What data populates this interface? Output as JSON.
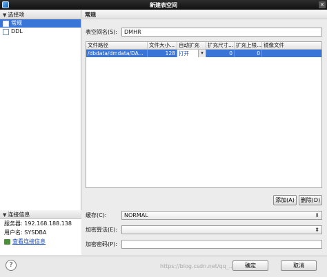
{
  "window": {
    "title": "新建表空间"
  },
  "left": {
    "section_label": "选择项",
    "items": [
      {
        "label": "常规",
        "selected": true
      },
      {
        "label": "DDL",
        "selected": false
      }
    ],
    "connection": {
      "section_label": "连接信息",
      "server_label": "服务器:",
      "server_value": "192.168.188.138",
      "user_label": "用户名:",
      "user_value": "SYSDBA",
      "view_link": "查看连接信息"
    }
  },
  "main": {
    "header": "常规",
    "tablespace_name_label": "表空间名(S):",
    "tablespace_name_value": "DMHR",
    "table": {
      "columns": [
        "文件路径",
        "文件大小...",
        "自动扩充",
        "扩充尺寸...",
        "扩充上限...",
        "镜像文件"
      ],
      "rows": [
        {
          "path": "/dbdata/dmdata/DA...",
          "size": "128",
          "auto_extend": "打开",
          "extend_size": "0",
          "extend_max": "0",
          "mirror": ""
        }
      ]
    },
    "add_button": "添加(A)",
    "delete_button": "删除(D)",
    "cache_label": "缓存(C):",
    "cache_value": "NORMAL",
    "encrypt_algo_label": "加密算法(E):",
    "encrypt_algo_value": "",
    "encrypt_pwd_label": "加密密码(P):",
    "encrypt_pwd_value": ""
  },
  "footer": {
    "ok_button": "确定",
    "cancel_button": "取消",
    "watermark": "https://blog.csdn.net/qq_..."
  }
}
